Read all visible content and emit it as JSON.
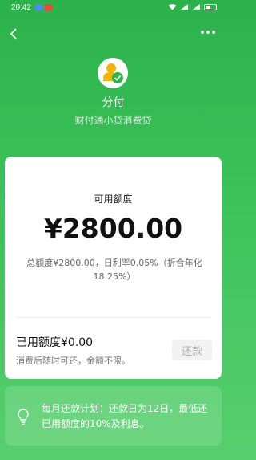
{
  "status_bar": {
    "time": "20:42",
    "app_icon_colors": [
      "#4a8fe7",
      "#e84a3c"
    ],
    "icons": [
      "wifi-icon",
      "signal-icon",
      "signal-icon",
      "battery-icon"
    ]
  },
  "header": {
    "back_icon": "chevron-left-icon",
    "more_icon": "more-dots-icon"
  },
  "brand": {
    "name": "分付",
    "subtitle": "财付通小贷消费贷",
    "logo_colors": [
      "#f4b400",
      "#2cb24a"
    ]
  },
  "credit_card": {
    "available_label": "可用额度",
    "available_amount": "¥2800.00",
    "detail": "总额度¥2800.00，日利率0.05%（折合年化18.25%）",
    "used_label": "已用额度¥0.00",
    "used_note": "消费后随时可还，金额不限。",
    "repay_button": "还款"
  },
  "plan": {
    "icon": "lightbulb-icon",
    "text": "每月还款计划：还款日为12日，最低还已用额度的10%及利息。"
  },
  "colors": {
    "brand_green": "#2cb24a",
    "disabled_button_bg": "#f2f2f2",
    "disabled_button_text": "#b3b3b3"
  }
}
